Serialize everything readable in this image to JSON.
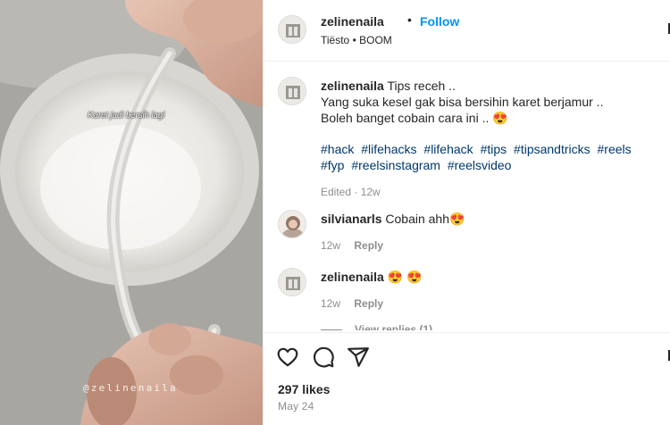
{
  "media": {
    "overlay_caption": "Karet jadi bersih lagi",
    "watermark": "@zelinenaila"
  },
  "header": {
    "username": "zelinenaila",
    "separator": "•",
    "follow_label": "Follow",
    "audio": "Tiësto • BOOM"
  },
  "caption": {
    "username": "zelinenaila",
    "lines": [
      "Tips receh ..",
      "Yang suka kesel gak bisa bersihin karet berjamur ..",
      "Boleh banget cobain cara ini .. 😍"
    ],
    "hashtags": [
      "#hack",
      "#lifehacks",
      "#lifehack",
      "#tips",
      "#tipsandtricks",
      "#reels",
      "#fyp",
      "#reelsinstagram",
      "#reelsvideo"
    ],
    "meta": "Edited · 12w"
  },
  "comments": [
    {
      "username": "silvianarls",
      "text": "Cobain ahh😍",
      "time": "12w",
      "reply_label": "Reply"
    },
    {
      "username": "zelinenaila",
      "text": "😍 😍",
      "time": "12w",
      "reply_label": "Reply"
    }
  ],
  "view_replies": "View replies (1)",
  "likes": "297 likes",
  "date": "May 24",
  "icons": {
    "like": "heart-icon",
    "comment": "comment-icon",
    "share": "share-icon"
  },
  "colors": {
    "link": "#0095f6",
    "hashtag": "#00376b",
    "muted": "#8e8e8e"
  }
}
